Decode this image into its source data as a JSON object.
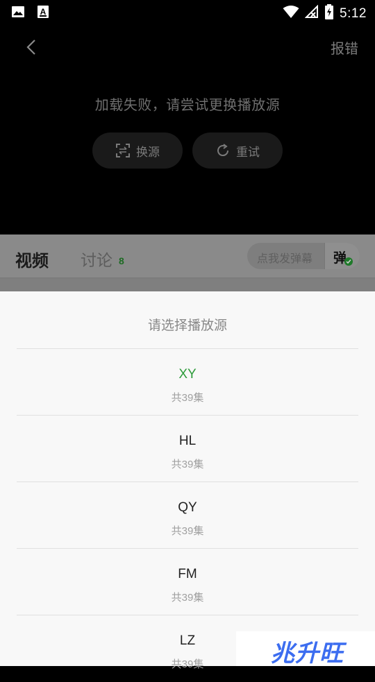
{
  "status_bar": {
    "time": "5:12",
    "left_icons": [
      "image-icon",
      "a-box-icon"
    ],
    "right_icons": [
      "wifi-icon",
      "no-signal-icon",
      "battery-charging-icon"
    ]
  },
  "player": {
    "report_label": "报错",
    "error_message": "加载失败，请尝试更换播放源",
    "switch_source_label": "换源",
    "retry_label": "重试"
  },
  "tabs": {
    "video_label": "视频",
    "discuss_label": "讨论",
    "discuss_count": "8",
    "danmu_placeholder": "点我发弹幕",
    "danmu_button_label": "弹"
  },
  "source_sheet": {
    "title": "请选择播放源",
    "options": [
      {
        "name": "XY",
        "episodes": "共39集",
        "selected": true
      },
      {
        "name": "HL",
        "episodes": "共39集",
        "selected": false
      },
      {
        "name": "QY",
        "episodes": "共39集",
        "selected": false
      },
      {
        "name": "FM",
        "episodes": "共39集",
        "selected": false
      },
      {
        "name": "LZ",
        "episodes": "共39集",
        "selected": false
      }
    ]
  },
  "watermark": {
    "text": "兆升旺"
  },
  "colors": {
    "accent_green": "#2e9b3b",
    "sheet_background": "#f8f8f8",
    "player_background": "#000000"
  }
}
